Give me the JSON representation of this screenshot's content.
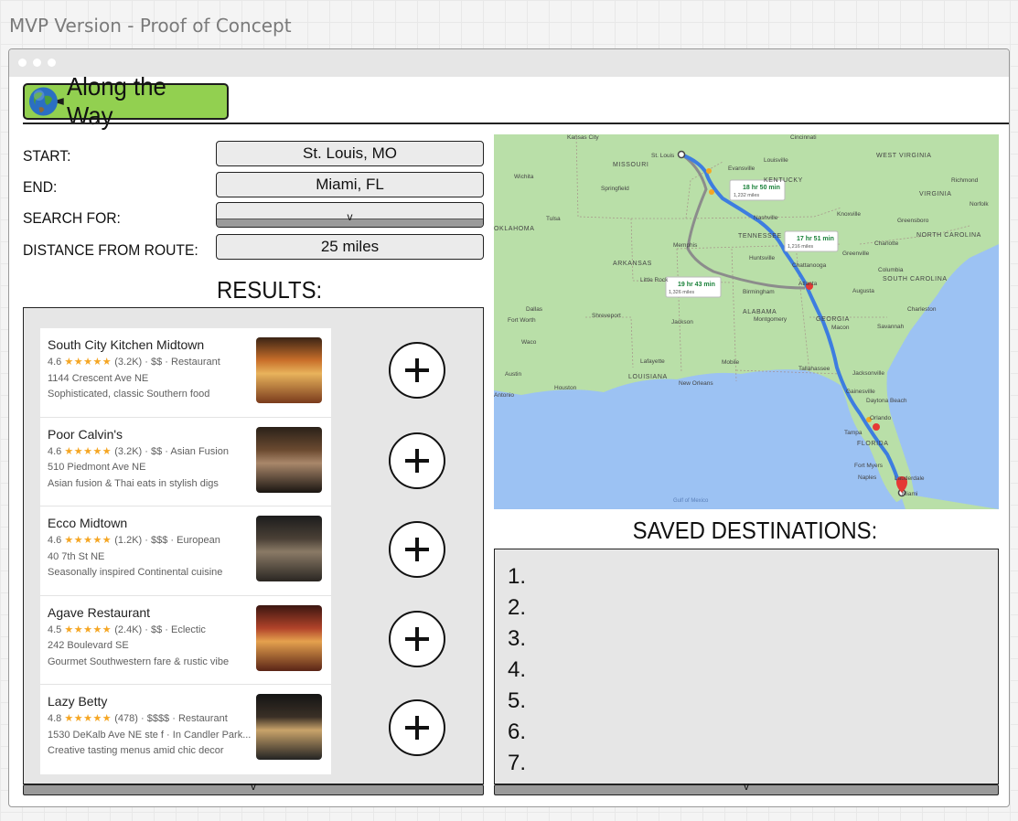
{
  "frame_title": "MVP Version - Proof of Concept",
  "app": {
    "name": "Along the Way"
  },
  "form": {
    "start_label": "START:",
    "start_value": "St. Louis, MO",
    "end_label": "END:",
    "end_value": "Miami, FL",
    "search_label": "SEARCH FOR:",
    "search_value": "",
    "distance_label": "DISTANCE FROM ROUTE:",
    "distance_value": "25 miles"
  },
  "results": {
    "title": "RESULTS:",
    "items": [
      {
        "name": "South City Kitchen Midtown",
        "rating": "4.6",
        "stars": "★★★★★",
        "reviews": "(3.2K)",
        "meta": "· $$ · Restaurant",
        "address": "1144 Crescent Ave NE",
        "desc": "Sophisticated, classic Southern food"
      },
      {
        "name": "Poor Calvin's",
        "rating": "4.6",
        "stars": "★★★★★",
        "reviews": "(3.2K)",
        "meta": "· $$ · Asian Fusion",
        "address": "510 Piedmont Ave NE",
        "desc": "Asian fusion & Thai eats in stylish digs"
      },
      {
        "name": "Ecco Midtown",
        "rating": "4.6",
        "stars": "★★★★★",
        "reviews": "(1.2K)",
        "meta": "· $$$ · European",
        "address": "40 7th St NE",
        "desc": "Seasonally inspired Continental cuisine"
      },
      {
        "name": "Agave Restaurant",
        "rating": "4.5",
        "stars": "★★★★★",
        "reviews": "(2.4K)",
        "meta": "· $$ · Eclectic",
        "address": "242 Boulevard SE",
        "desc": "Gourmet Southwestern fare & rustic vibe"
      },
      {
        "name": "Lazy Betty",
        "rating": "4.8",
        "stars": "★★★★★",
        "reviews": "(478)",
        "meta": "· $$$$ · Restaurant",
        "address": "1530 DeKalb Ave NE ste f · In Candler Park...",
        "desc": "Creative tasting menus amid chic decor"
      }
    ]
  },
  "map": {
    "routes": [
      {
        "time": "18 hr 50 min",
        "distance": "1,232 miles"
      },
      {
        "time": "17 hr 51 min",
        "distance": "1,216 miles"
      },
      {
        "time": "19 hr 43 min",
        "distance": "1,326 miles"
      }
    ],
    "places": {
      "states": [
        "MISSOURI",
        "KENTUCKY",
        "TENNESSEE",
        "ARKANSAS",
        "OKLAHOMA",
        "ALABAMA",
        "GEORGIA",
        "LOUISIANA",
        "FLORIDA",
        "SOUTH CAROLINA",
        "NORTH CAROLINA",
        "VIRGINIA",
        "WEST VIRGINIA"
      ],
      "cities": [
        "Kansas City",
        "St. Louis",
        "Louisville",
        "Cincinnati",
        "Nashville",
        "Memphis",
        "Atlanta",
        "Charlotte",
        "Birmingham",
        "Jackson",
        "Dallas",
        "Fort Worth",
        "Shreveport",
        "Houston",
        "Austin",
        "Antonio",
        "New Orleans",
        "Jacksonville",
        "Orlando",
        "Tampa",
        "Miami",
        "Tallahassee",
        "Savannah",
        "Charleston",
        "Montgomery",
        "Little Rock",
        "Tulsa",
        "Springfield",
        "Evansville",
        "Knoxville",
        "Greenville",
        "Columbia",
        "Augusta",
        "Macon",
        "Mobile",
        "Gainesville",
        "Fort Myers",
        "Naples",
        "Daytona Beach",
        "Lauderdale",
        "Huntsville",
        "Chattanooga",
        "Greensboro",
        "Richmond",
        "Norfolk",
        "Wichita",
        "Waco",
        "Lafayette"
      ]
    },
    "water": "Gulf of Mexico"
  },
  "saved": {
    "title": "SAVED DESTINATIONS:",
    "items": [
      "1.",
      "2.",
      "3.",
      "4.",
      "5.",
      "6.",
      "7."
    ]
  }
}
